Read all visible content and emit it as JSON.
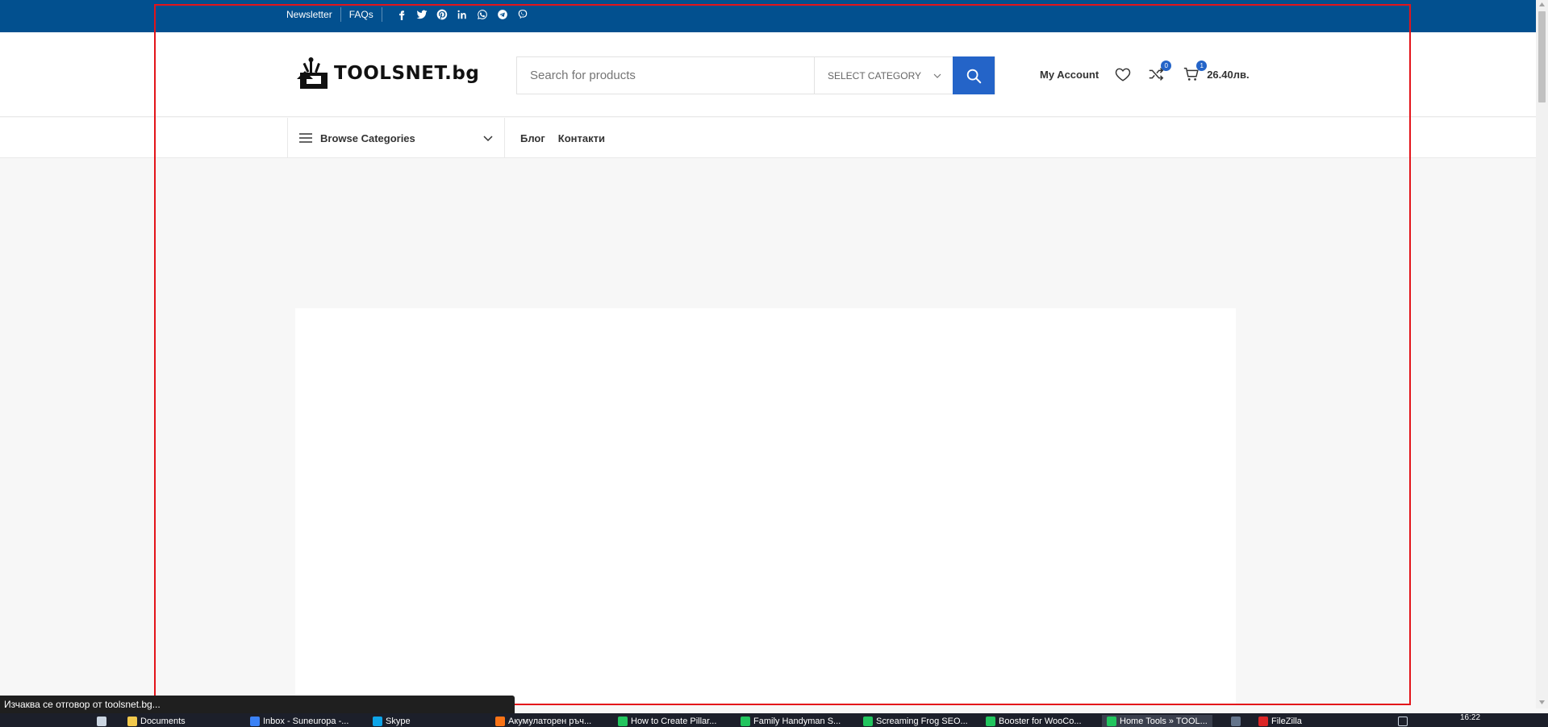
{
  "topbar": {
    "links": [
      "Newsletter",
      "FAQs"
    ],
    "social_icons": [
      "facebook-icon",
      "twitter-icon",
      "pinterest-icon",
      "linkedin-icon",
      "whatsapp-icon",
      "telegram-icon",
      "viber-icon"
    ],
    "bg_color": "#02508f"
  },
  "header": {
    "logo_text": "TOOLSNET.bg",
    "search": {
      "placeholder": "Search for products",
      "category_label": "SELECT CATEGORY",
      "button_color": "#2464c8"
    },
    "account_label": "My Account",
    "compare_count": "0",
    "cart_count": "1",
    "cart_total": "26.40лв."
  },
  "nav": {
    "browse_label": "Browse Categories",
    "menu": [
      "Блог",
      "Контакти"
    ]
  },
  "status_text": "Изчаква се отговор от toolsnet.bg...",
  "taskbar": {
    "items": [
      {
        "label": "Documents",
        "icon": "folder-icon",
        "color": "#f2c94c"
      },
      {
        "label": "Inbox - Suneuropa -...",
        "icon": "mail-icon",
        "color": "#3b82f6"
      },
      {
        "label": "Skype",
        "icon": "skype-icon",
        "color": "#0ea5e9"
      },
      {
        "label": "Акумулаторен ръч...",
        "icon": "firefox-icon",
        "color": "#f97316"
      },
      {
        "label": "How to Create Pillar...",
        "icon": "chrome-icon",
        "color": "#22c55e"
      },
      {
        "label": "Family Handyman S...",
        "icon": "chrome-icon",
        "color": "#22c55e"
      },
      {
        "label": "Screaming Frog SEO...",
        "icon": "chrome-icon",
        "color": "#22c55e"
      },
      {
        "label": "Booster for WooCo...",
        "icon": "chrome-icon",
        "color": "#22c55e"
      },
      {
        "label": "Home Tools » TOOL...",
        "icon": "chrome-icon",
        "color": "#22c55e"
      },
      {
        "label": "FileZilla",
        "icon": "filezilla-icon",
        "color": "#dc2626"
      }
    ],
    "clock": "16:22"
  }
}
